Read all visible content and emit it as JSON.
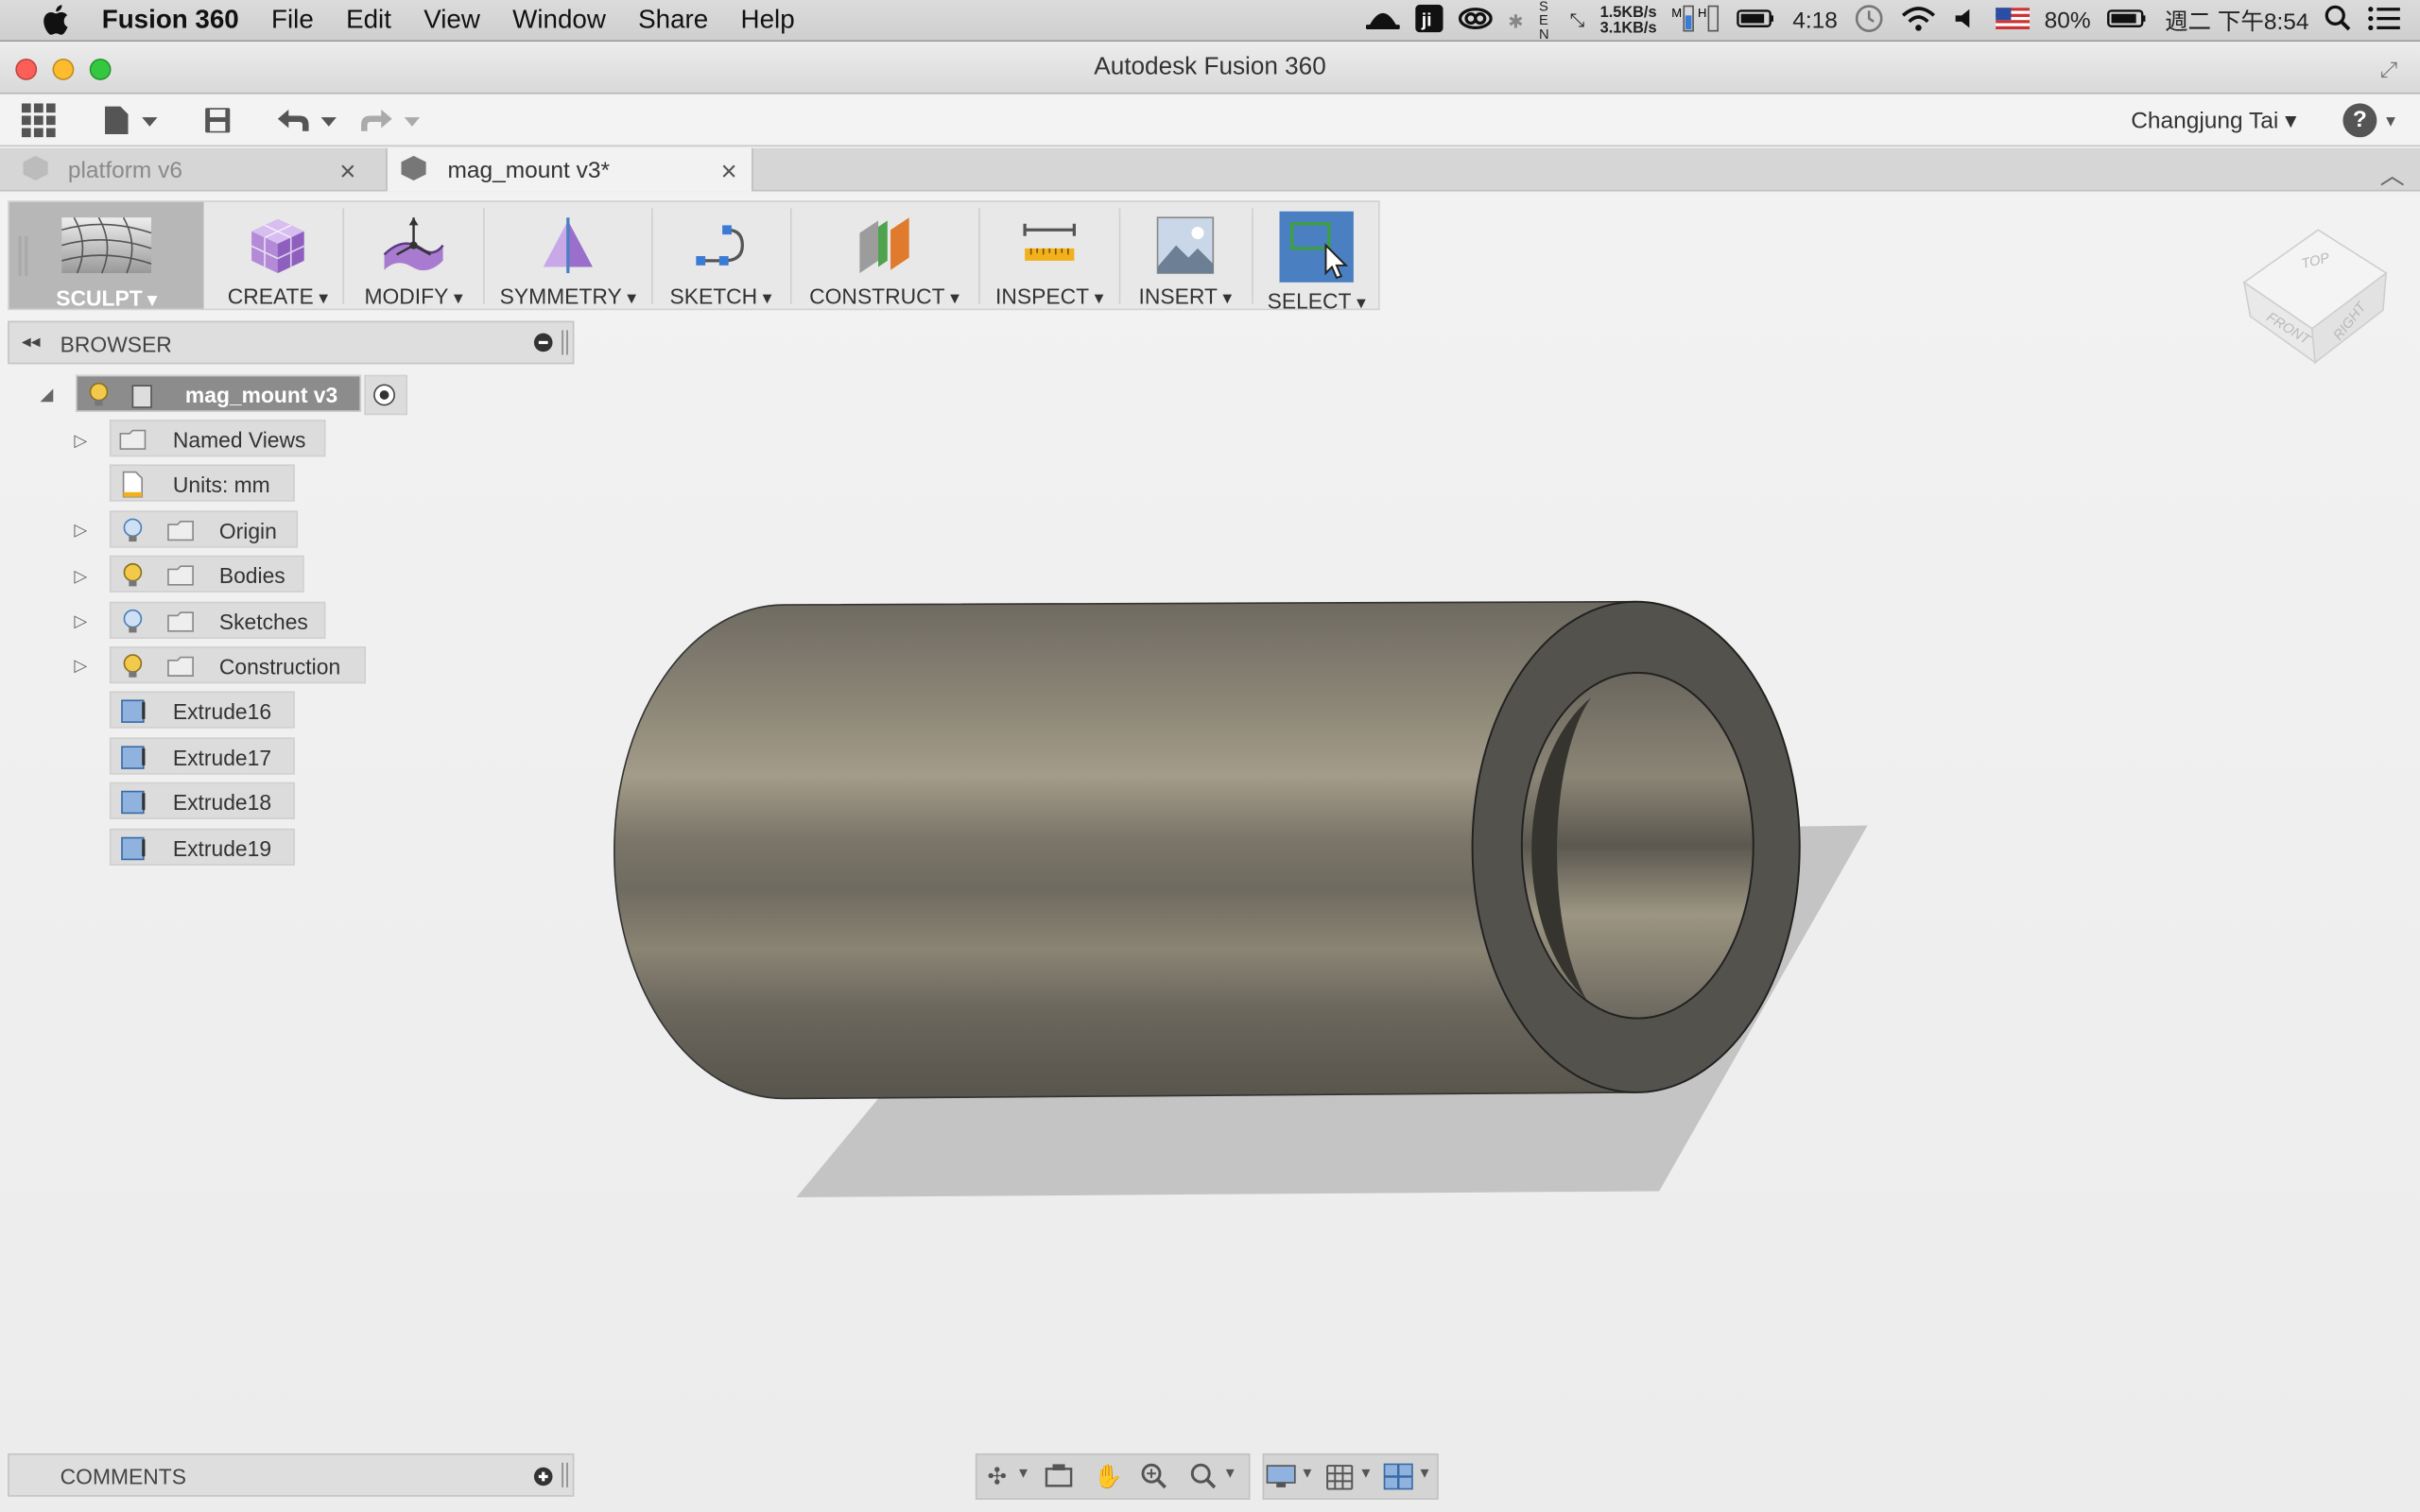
{
  "menubar": {
    "app_name": "Fusion 360",
    "items": [
      "File",
      "Edit",
      "View",
      "Window",
      "Share",
      "Help"
    ],
    "status": {
      "net_up": "1.5KB/s",
      "net_down": "3.1KB/s",
      "clock_short": "4:18",
      "battery": "80%",
      "datetime": "週二 下午8:54"
    }
  },
  "window": {
    "title": "Autodesk Fusion 360"
  },
  "toolbar": {
    "user": "Changjung Tai"
  },
  "tabs": [
    {
      "label": "platform v6",
      "active": false
    },
    {
      "label": "mag_mount v3*",
      "active": true
    }
  ],
  "ribbon": {
    "groups": [
      "SCULPT",
      "CREATE",
      "MODIFY",
      "SYMMETRY",
      "SKETCH",
      "CONSTRUCT",
      "INSPECT",
      "INSERT",
      "SELECT"
    ]
  },
  "browser": {
    "title": "BROWSER",
    "root": "mag_mount v3",
    "nodes": [
      {
        "label": "Named Views"
      },
      {
        "label": "Units: mm"
      },
      {
        "label": "Origin"
      },
      {
        "label": "Bodies"
      },
      {
        "label": "Sketches"
      },
      {
        "label": "Construction"
      },
      {
        "label": "Extrude16"
      },
      {
        "label": "Extrude17"
      },
      {
        "label": "Extrude18"
      },
      {
        "label": "Extrude19"
      }
    ]
  },
  "comments": {
    "title": "COMMENTS"
  },
  "viewcube": {
    "top": "TOP",
    "front": "FRONT",
    "right": "RIGHT"
  },
  "colors": {
    "select_active": "#4a7fc1",
    "sculpt_bg": "#b7b7b7",
    "bulb": "#f3c94b"
  }
}
